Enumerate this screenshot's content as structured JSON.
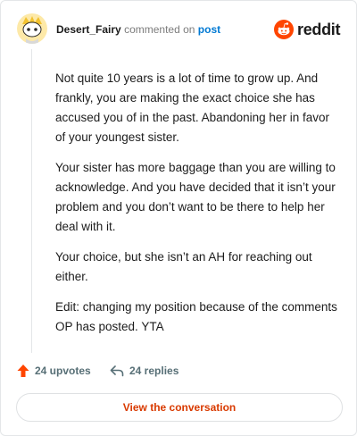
{
  "comment": {
    "author": "Desert_Fairy",
    "action_text": "commented on",
    "post_link": "post",
    "paragraphs": [
      "Not quite 10 years is a lot of time to grow up. And frankly, you are making the exact choice she has accused you of in the past. Abandoning her in favor of your youngest sister.",
      "Your sister has more baggage than you are willing to acknowledge. And you have decided that it isn’t your problem and you don’t want to be there to help her deal with it.",
      "Your choice, but she isn’t an AH for reaching out either.",
      "Edit: changing my position because of the comments OP has posted. YTA"
    ]
  },
  "brand": {
    "name": "reddit",
    "icon": "reddit-logo-icon",
    "color": "#ff4500"
  },
  "actions": {
    "upvotes_label": "24 upvotes",
    "upvote_icon": "upvote-arrow-icon",
    "replies_label": "24 replies",
    "reply_icon": "reply-arrow-icon"
  },
  "cta": {
    "label": "View the conversation"
  },
  "colors": {
    "accent": "#ff4500",
    "link": "#0079d3",
    "cta_text": "#d93a00"
  }
}
